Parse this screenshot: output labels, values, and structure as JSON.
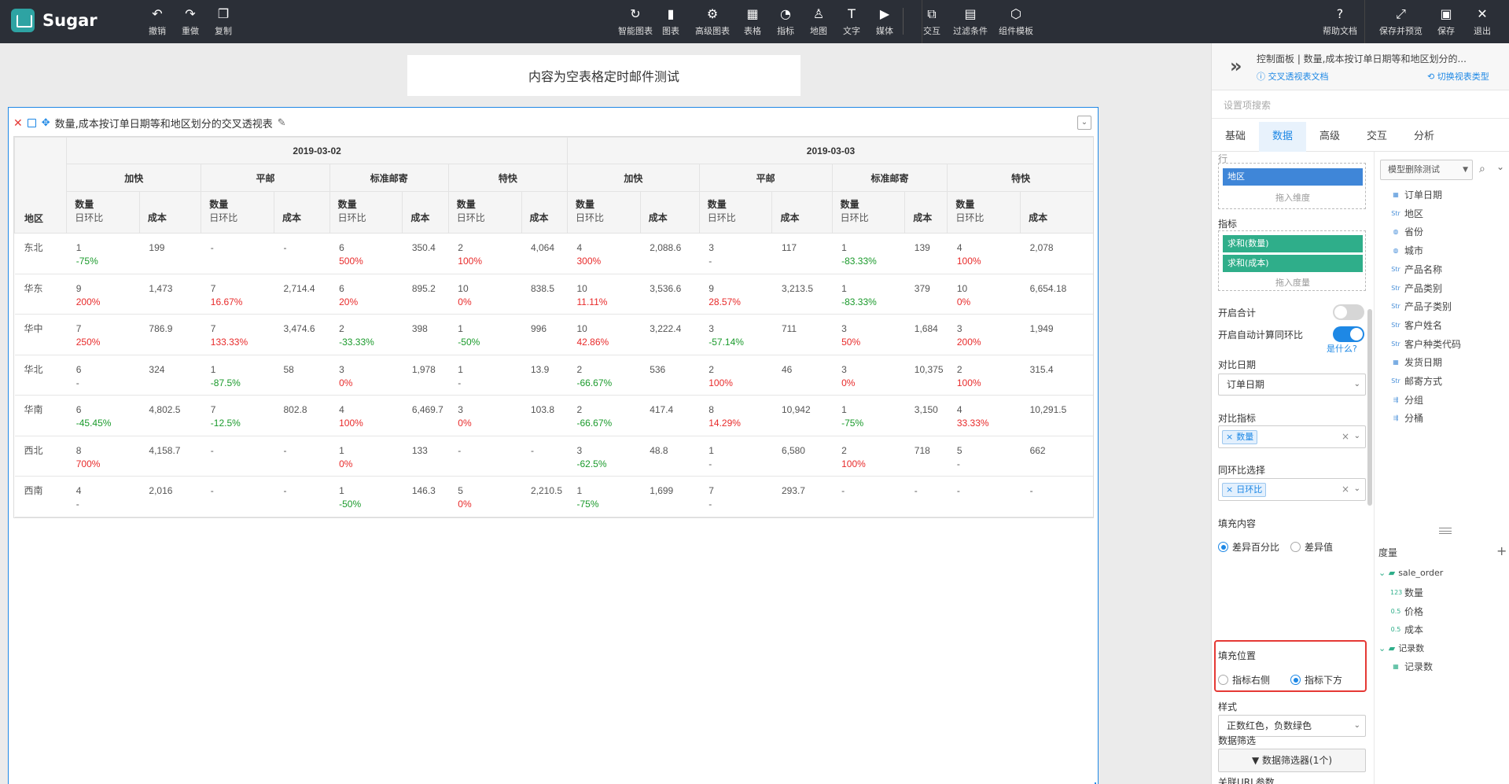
{
  "app": {
    "name": "Sugar"
  },
  "toolbar": {
    "left": [
      {
        "icon": "undo-icon",
        "glyph": "↶",
        "label": "撤销"
      },
      {
        "icon": "redo-icon",
        "glyph": "↷",
        "label": "重做"
      },
      {
        "icon": "copy-icon",
        "glyph": "❐",
        "label": "复制"
      }
    ],
    "center": [
      {
        "icon": "smart-chart-icon",
        "glyph": "↻",
        "label": "智能图表"
      },
      {
        "icon": "chart-icon",
        "glyph": "▮",
        "label": "图表"
      },
      {
        "icon": "advanced-chart-icon",
        "glyph": "⚙",
        "label": "高级图表"
      },
      {
        "icon": "table-icon",
        "glyph": "▦",
        "label": "表格"
      },
      {
        "icon": "indicator-icon",
        "glyph": "◔",
        "label": "指标"
      },
      {
        "icon": "map-icon",
        "glyph": "♙",
        "label": "地图"
      },
      {
        "icon": "text-icon",
        "glyph": "T",
        "label": "文字"
      },
      {
        "icon": "media-icon",
        "glyph": "▶",
        "label": "媒体"
      }
    ],
    "center2": [
      {
        "icon": "interaction-icon",
        "glyph": "⧉",
        "label": "交互"
      },
      {
        "icon": "filter-condition-icon",
        "glyph": "▤",
        "label": "过滤条件"
      },
      {
        "icon": "component-template-icon",
        "glyph": "⬡",
        "label": "组件模板"
      }
    ],
    "right": [
      {
        "icon": "help-icon",
        "glyph": "?",
        "label": "帮助文档"
      },
      {
        "icon": "save-preview-icon",
        "glyph": "⤢",
        "label": "保存并预览"
      },
      {
        "icon": "save-icon",
        "glyph": "▣",
        "label": "保存"
      },
      {
        "icon": "exit-icon",
        "glyph": "✕",
        "label": "退出"
      }
    ]
  },
  "canvas": {
    "title_card": "内容为空表格定时邮件测试"
  },
  "widget": {
    "title": "数量,成本按订单日期等和地区划分的交叉透视表",
    "region_header": "地区",
    "dates": [
      "2019-03-02",
      "2019-03-03"
    ],
    "ship_modes": [
      "加快",
      "平邮",
      "标准邮寄",
      "特快"
    ],
    "qty_label": "数量",
    "compare_label": "日环比",
    "cost_label": "成本",
    "rows": [
      {
        "region": "东北",
        "cells": [
          [
            "1",
            "-75%",
            "g"
          ],
          [
            "199"
          ],
          [
            "-",
            ""
          ],
          [
            "-"
          ],
          [
            "6",
            "500%",
            "r"
          ],
          [
            "350.4"
          ],
          [
            "2",
            "100%",
            "r"
          ],
          [
            "4,064"
          ],
          [
            "4",
            "300%",
            "r"
          ],
          [
            "2,088.6"
          ],
          [
            "3",
            "-",
            ""
          ],
          [
            "117"
          ],
          [
            "1",
            "-83.33%",
            "g"
          ],
          [
            "139"
          ],
          [
            "4",
            "100%",
            "r"
          ],
          [
            "2,078"
          ]
        ]
      },
      {
        "region": "华东",
        "cells": [
          [
            "9",
            "200%",
            "r"
          ],
          [
            "1,473"
          ],
          [
            "7",
            "16.67%",
            "r"
          ],
          [
            "2,714.4"
          ],
          [
            "6",
            "20%",
            "r"
          ],
          [
            "895.2"
          ],
          [
            "10",
            "0%",
            "r"
          ],
          [
            "838.5"
          ],
          [
            "10",
            "11.11%",
            "r"
          ],
          [
            "3,536.6"
          ],
          [
            "9",
            "28.57%",
            "r"
          ],
          [
            "3,213.5"
          ],
          [
            "1",
            "-83.33%",
            "g"
          ],
          [
            "379"
          ],
          [
            "10",
            "0%",
            "r"
          ],
          [
            "6,654.18"
          ]
        ]
      },
      {
        "region": "华中",
        "cells": [
          [
            "7",
            "250%",
            "r"
          ],
          [
            "786.9"
          ],
          [
            "7",
            "133.33%",
            "r"
          ],
          [
            "3,474.6"
          ],
          [
            "2",
            "-33.33%",
            "g"
          ],
          [
            "398"
          ],
          [
            "1",
            "-50%",
            "g"
          ],
          [
            "996"
          ],
          [
            "10",
            "42.86%",
            "r"
          ],
          [
            "3,222.4"
          ],
          [
            "3",
            "-57.14%",
            "g"
          ],
          [
            "711"
          ],
          [
            "3",
            "50%",
            "r"
          ],
          [
            "1,684"
          ],
          [
            "3",
            "200%",
            "r"
          ],
          [
            "1,949"
          ]
        ]
      },
      {
        "region": "华北",
        "cells": [
          [
            "6",
            "-",
            ""
          ],
          [
            "324"
          ],
          [
            "1",
            "-87.5%",
            "g"
          ],
          [
            "58"
          ],
          [
            "3",
            "0%",
            "r"
          ],
          [
            "1,978"
          ],
          [
            "1",
            "-",
            ""
          ],
          [
            "13.9"
          ],
          [
            "2",
            "-66.67%",
            "g"
          ],
          [
            "536"
          ],
          [
            "2",
            "100%",
            "r"
          ],
          [
            "46"
          ],
          [
            "3",
            "0%",
            "r"
          ],
          [
            "10,375"
          ],
          [
            "2",
            "100%",
            "r"
          ],
          [
            "315.4"
          ]
        ]
      },
      {
        "region": "华南",
        "cells": [
          [
            "6",
            "-45.45%",
            "g"
          ],
          [
            "4,802.5"
          ],
          [
            "7",
            "-12.5%",
            "g"
          ],
          [
            "802.8"
          ],
          [
            "4",
            "100%",
            "r"
          ],
          [
            "6,469.7"
          ],
          [
            "3",
            "0%",
            "r"
          ],
          [
            "103.8"
          ],
          [
            "2",
            "-66.67%",
            "g"
          ],
          [
            "417.4"
          ],
          [
            "8",
            "14.29%",
            "r"
          ],
          [
            "10,942"
          ],
          [
            "1",
            "-75%",
            "g"
          ],
          [
            "3,150"
          ],
          [
            "4",
            "33.33%",
            "r"
          ],
          [
            "10,291.5"
          ]
        ]
      },
      {
        "region": "西北",
        "cells": [
          [
            "8",
            "700%",
            "r"
          ],
          [
            "4,158.7"
          ],
          [
            "-",
            ""
          ],
          [
            "-"
          ],
          [
            "1",
            "0%",
            "r"
          ],
          [
            "133"
          ],
          [
            "-",
            ""
          ],
          [
            "-"
          ],
          [
            "3",
            "-62.5%",
            "g"
          ],
          [
            "48.8"
          ],
          [
            "1",
            "-",
            ""
          ],
          [
            "6,580"
          ],
          [
            "2",
            "100%",
            "r"
          ],
          [
            "718"
          ],
          [
            "5",
            "-",
            ""
          ],
          [
            "662"
          ]
        ]
      },
      {
        "region": "西南",
        "cells": [
          [
            "4",
            "-",
            ""
          ],
          [
            "2,016"
          ],
          [
            "-",
            ""
          ],
          [
            "-"
          ],
          [
            "1",
            "-50%",
            "g"
          ],
          [
            "146.3"
          ],
          [
            "5",
            "0%",
            "r"
          ],
          [
            "2,210.5"
          ],
          [
            "1",
            "-75%",
            "g"
          ],
          [
            "1,699"
          ],
          [
            "7",
            "-",
            ""
          ],
          [
            "293.7"
          ],
          [
            "-",
            ""
          ],
          [
            "-"
          ],
          [
            "-",
            ""
          ],
          [
            "-"
          ]
        ]
      }
    ]
  },
  "panel": {
    "title": "控制面板 | 数量,成本按订单日期等和地区划分的...",
    "link_doc": "ⓘ 交叉透视表文档",
    "link_switch": "⟲ 切换视表类型",
    "search_placeholder": "设置项搜索",
    "tabs": [
      "基础",
      "数据",
      "高级",
      "交互",
      "分析"
    ],
    "active_tab": 1,
    "dimension_pill": "地区",
    "drop_dimension": "拖入维度",
    "metrics_label": "指标",
    "metric_pills": [
      "求和(数量)",
      "求和(成本)"
    ],
    "drop_measure": "拖入度量",
    "total_label": "开启合计",
    "auto_compare_label": "开启自动计算同环比",
    "what_is": "是什么?",
    "compare_date_label": "对比日期",
    "compare_date_value": "订单日期",
    "compare_metric_label": "对比指标",
    "compare_metric_tag": "数量",
    "compare_type_label": "同环比选择",
    "compare_type_tag": "日环比",
    "fill_content_label": "填充内容",
    "fill_content_opt1": "差异百分比",
    "fill_content_opt2": "差异值",
    "fill_position_label": "填充位置",
    "fill_position_opt1": "指标右侧",
    "fill_position_opt2": "指标下方",
    "style_label": "样式",
    "style_value": "正数红色，负数绿色",
    "data_filter_label": "数据筛选",
    "data_filter_button": "数据筛选器(1个)",
    "url_params_label": "关联URL参数"
  },
  "datapanel": {
    "model_select": "模型删除测试",
    "fields": [
      {
        "type": "date",
        "icon": "▦",
        "name": "订单日期"
      },
      {
        "type": "str",
        "icon": "Str",
        "name": "地区"
      },
      {
        "type": "geo",
        "icon": "◍",
        "name": "省份"
      },
      {
        "type": "geo",
        "icon": "◍",
        "name": "城市"
      },
      {
        "type": "str",
        "icon": "Str",
        "name": "产品名称"
      },
      {
        "type": "str",
        "icon": "Str",
        "name": "产品类别"
      },
      {
        "type": "str",
        "icon": "Str",
        "name": "产品子类别"
      },
      {
        "type": "str",
        "icon": "Str",
        "name": "客户姓名"
      },
      {
        "type": "str",
        "icon": "Str",
        "name": "客户种类代码"
      },
      {
        "type": "date",
        "icon": "▦",
        "name": "发货日期"
      },
      {
        "type": "str",
        "icon": "Str",
        "name": "邮寄方式"
      },
      {
        "type": "group",
        "icon": "⇶",
        "name": "分组"
      },
      {
        "type": "group",
        "icon": "⇶",
        "name": "分桶"
      }
    ],
    "measure_label": "度量",
    "folder1": "sale_order",
    "measures": [
      {
        "icon": "123",
        "name": "数量"
      },
      {
        "icon": "0.5",
        "name": "价格"
      },
      {
        "icon": "0.5",
        "name": "成本"
      }
    ],
    "folder2": "记录数",
    "records": [
      {
        "icon": "▦",
        "name": "记录数"
      }
    ]
  },
  "colors": {
    "positive": "#e82a2a",
    "negative": "#1a9a2b",
    "accent": "#1e88e5",
    "topbar": "#2b2f37",
    "highlight_box": "#e53935"
  }
}
